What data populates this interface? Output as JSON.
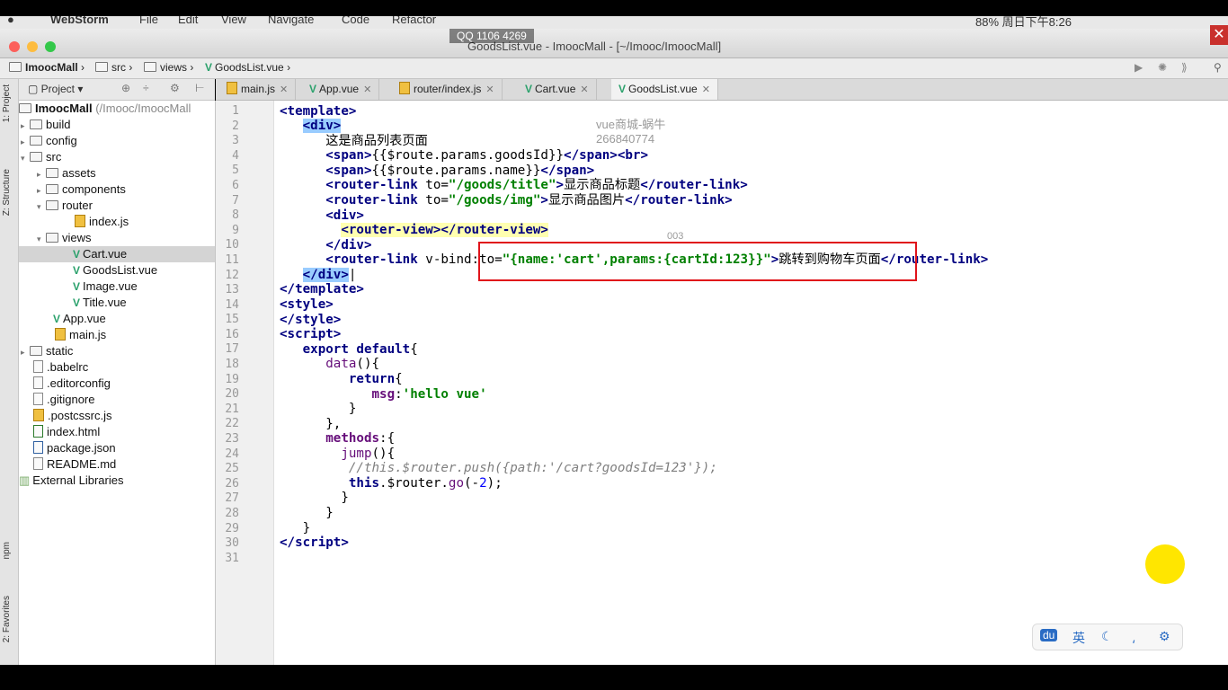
{
  "menubar": {
    "app": "WebStorm",
    "items": [
      "File",
      "Edit",
      "View",
      "Navigate",
      "Code",
      "Refactor"
    ],
    "status": "88%  周日下午8:26"
  },
  "window": {
    "title": "GoodsList.vue - ImoocMall - [~/Imooc/ImoocMall]",
    "player_title": "QQ 1106 4269"
  },
  "breadcrumb": [
    "ImoocMall",
    "src",
    "views",
    "GoodsList.vue"
  ],
  "toolwindows": {
    "project": "1: Project",
    "structure": "Z: Structure",
    "npm": "npm",
    "favorites": "2: Favorites"
  },
  "project_header": {
    "label": "Project"
  },
  "tree": [
    {
      "label": "ImoocMall",
      "extra": "(/Imooc/ImoocMall",
      "type": "root"
    },
    {
      "label": "build",
      "type": "folder"
    },
    {
      "label": "config",
      "type": "folder"
    },
    {
      "label": "src",
      "type": "folder"
    },
    {
      "label": "assets",
      "type": "folder"
    },
    {
      "label": "components",
      "type": "folder"
    },
    {
      "label": "router",
      "type": "folder"
    },
    {
      "label": "index.js",
      "type": "js"
    },
    {
      "label": "views",
      "type": "folder"
    },
    {
      "label": "Cart.vue",
      "type": "vue"
    },
    {
      "label": "GoodsList.vue",
      "type": "vue"
    },
    {
      "label": "Image.vue",
      "type": "vue"
    },
    {
      "label": "Title.vue",
      "type": "vue"
    },
    {
      "label": "App.vue",
      "type": "vue"
    },
    {
      "label": "main.js",
      "type": "js"
    },
    {
      "label": "static",
      "type": "folder"
    },
    {
      "label": ".babelrc",
      "type": "file"
    },
    {
      "label": ".editorconfig",
      "type": "file"
    },
    {
      "label": ".gitignore",
      "type": "file"
    },
    {
      "label": ".postcssrc.js",
      "type": "js"
    },
    {
      "label": "index.html",
      "type": "file"
    },
    {
      "label": "package.json",
      "type": "file"
    },
    {
      "label": "README.md",
      "type": "file"
    },
    {
      "label": "External Libraries",
      "type": "lib"
    }
  ],
  "tabs": [
    "main.js",
    "App.vue",
    "router/index.js",
    "Cart.vue",
    "GoodsList.vue"
  ],
  "watermark": {
    "line1": "vue商城-蜗牛",
    "line2": "266840774",
    "num": "003"
  },
  "ime": {
    "lang": "英"
  }
}
